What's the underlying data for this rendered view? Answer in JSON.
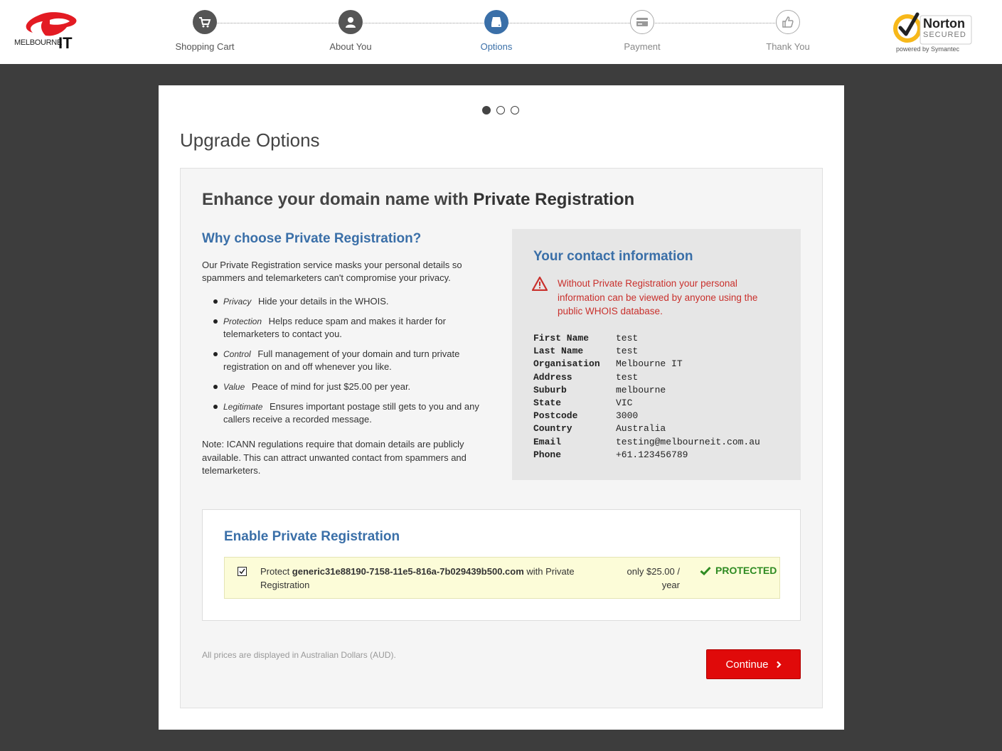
{
  "header": {
    "brand": {
      "wordmark": "MELBOURNE",
      "suffix": "IT"
    },
    "steps": [
      {
        "label": "Shopping Cart",
        "state": "done",
        "icon": "cart-icon"
      },
      {
        "label": "About You",
        "state": "done",
        "icon": "user-icon"
      },
      {
        "label": "Options",
        "state": "active",
        "icon": "drive-icon"
      },
      {
        "label": "Payment",
        "state": "todo",
        "icon": "card-icon"
      },
      {
        "label": "Thank You",
        "state": "todo",
        "icon": "thumbs-up-icon"
      }
    ],
    "norton": {
      "name": "Norton",
      "secured": "SECURED",
      "powered": "powered by Symantec"
    }
  },
  "main": {
    "carousel": {
      "count": 3,
      "active": 0
    },
    "title": "Upgrade Options",
    "headline_prefix": "Enhance your domain name with ",
    "headline_bold": "Private Registration",
    "why": {
      "title": "Why choose Private Registration?",
      "intro": "Our Private Registration service masks your personal details so spammers and telemarketers can't compromise your privacy.",
      "benefits": [
        {
          "term": "Privacy",
          "text": "Hide your details in the WHOIS."
        },
        {
          "term": "Protection",
          "text": "Helps reduce spam and makes it harder for telemarketers to contact you."
        },
        {
          "term": "Control",
          "text": "Full management of your domain and turn private registration on and off whenever you like."
        },
        {
          "term": "Value",
          "text": "Peace of mind for just $25.00 per year."
        },
        {
          "term": "Legitimate",
          "text": "Ensures important postage still gets to you and any callers receive a recorded message."
        }
      ],
      "note": "Note: ICANN regulations require that domain details are publicly available. This can attract unwanted contact from spammers and telemarketers."
    },
    "contact": {
      "title": "Your contact information",
      "warning": "Without Private Registration your personal information can be viewed by anyone using the public WHOIS database.",
      "fields": [
        {
          "key": "First Name",
          "value": "test"
        },
        {
          "key": "Last Name",
          "value": "test"
        },
        {
          "key": "Organisation",
          "value": "Melbourne IT"
        },
        {
          "key": "Address",
          "value": "test"
        },
        {
          "key": "Suburb",
          "value": "melbourne"
        },
        {
          "key": "State",
          "value": "VIC"
        },
        {
          "key": "Postcode",
          "value": "3000"
        },
        {
          "key": "Country",
          "value": "Australia"
        },
        {
          "key": "Email",
          "value": "testing@melbourneit.com.au"
        },
        {
          "key": "Phone",
          "value": "+61.123456789"
        }
      ]
    },
    "enable": {
      "title": "Enable Private Registration",
      "checked": true,
      "protect_prefix": "Protect ",
      "domain": "generic31e88190-7158-11e5-816a-7b029439b500.com",
      "protect_suffix": " with Private Registration",
      "price": "only $25.00 / year",
      "status": "PROTECTED"
    },
    "footnote": "All prices are displayed in Australian Dollars (AUD).",
    "continue_label": "Continue"
  },
  "colors": {
    "accent": "#3a6fa8",
    "danger": "#c9302c",
    "button": "#e00a0a",
    "success": "#2e8b22",
    "backdrop": "#3d3d3d"
  }
}
